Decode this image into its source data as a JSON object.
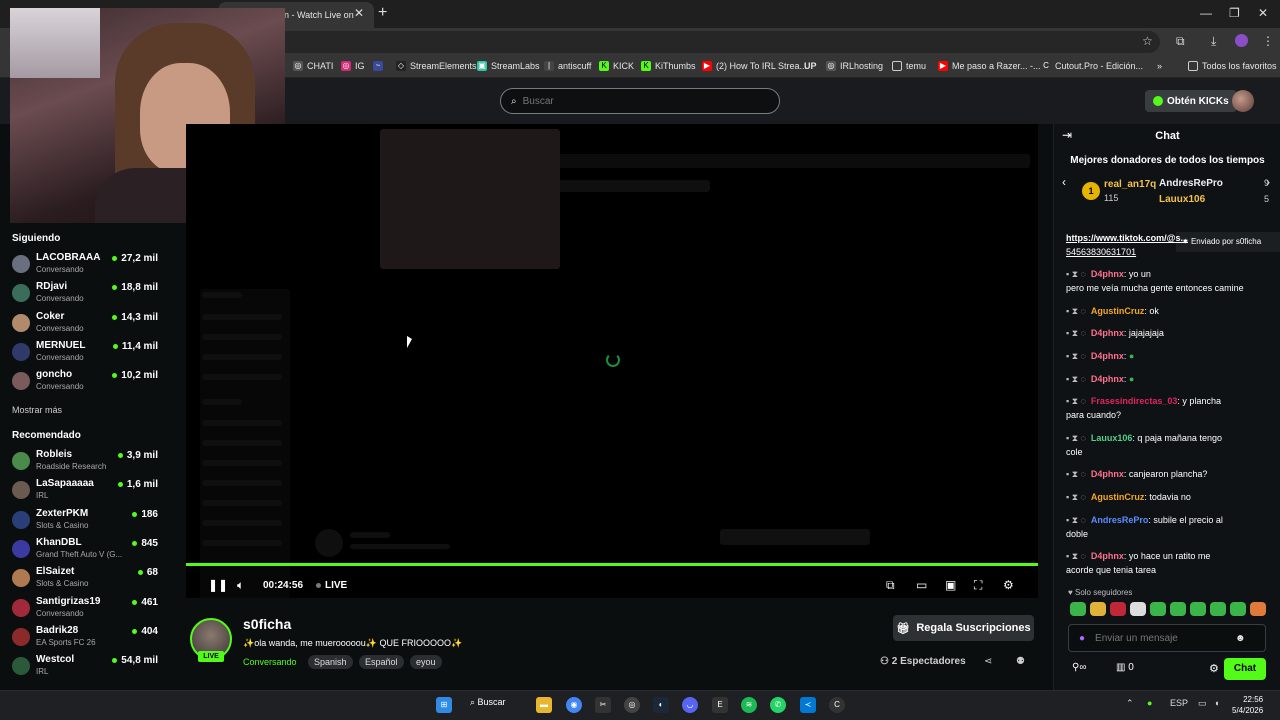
{
  "browser": {
    "active_tab_title": "n - Watch Live on",
    "bookmarks": [
      "CHATI",
      "IG",
      "StreamElements",
      "StreamLabs",
      "antiscuff",
      "KICK",
      "KiThumbs",
      "(2) How To IRL Strea...",
      "UP",
      "IRLhosting",
      "temu",
      "Me paso a Razer... -...",
      "Cutout.Pro - Edición...",
      "Todos los favoritos"
    ]
  },
  "header": {
    "search_placeholder": "Buscar",
    "kicks_label": "Obtén KICKs"
  },
  "sidebar": {
    "following_title": "Siguiendo",
    "following": [
      {
        "name": "LACOBRAAA",
        "category": "Conversando",
        "viewers": "27,2 mil"
      },
      {
        "name": "RDjavi",
        "category": "Conversando",
        "viewers": "18,8 mil"
      },
      {
        "name": "Coker",
        "category": "Conversando",
        "viewers": "14,3 mil"
      },
      {
        "name": "MERNUEL",
        "category": "Conversando",
        "viewers": "11,4 mil"
      },
      {
        "name": "goncho",
        "category": "Conversando",
        "viewers": "10,2 mil"
      }
    ],
    "show_more": "Mostrar más",
    "recommended_title": "Recomendado",
    "recommended": [
      {
        "name": "Robleis",
        "category": "Roadside Research",
        "viewers": "3,9 mil"
      },
      {
        "name": "LaSapaaaaa",
        "category": "IRL",
        "viewers": "1,6 mil"
      },
      {
        "name": "ZexterPKM",
        "category": "Slots & Casino",
        "viewers": "186"
      },
      {
        "name": "KhanDBL",
        "category": "Grand Theft Auto V (G...",
        "viewers": "845"
      },
      {
        "name": "ElSaizet",
        "category": "Slots & Casino",
        "viewers": "68"
      },
      {
        "name": "Santigrizas19",
        "category": "Conversando",
        "viewers": "461"
      },
      {
        "name": "Badrik28",
        "category": "EA Sports FC 26",
        "viewers": "404"
      },
      {
        "name": "Westcol",
        "category": "IRL",
        "viewers": "54,8 mil"
      }
    ]
  },
  "player": {
    "time": "00:24:56",
    "live_label": "LIVE"
  },
  "stream": {
    "streamer": "s0ficha",
    "live_badge": "LIVE",
    "title": "✨ola wanda, me muerooooou✨ QUE FRIOOOOO✨",
    "category": "Conversando",
    "tags": [
      "Spanish",
      "Español",
      "eyou"
    ],
    "gift_label": "Regala Suscripciones",
    "viewers_count": "2",
    "viewers_label": "Espectadores"
  },
  "chat": {
    "title": "Chat",
    "donors_title": "Mejores donadores de todos los tiempos",
    "top_donor": {
      "rank": "1",
      "name": "real_an17q",
      "amount": "115"
    },
    "donors": [
      {
        "name": "AndresRePro",
        "amount": "9",
        "color": "#f0f0f0"
      },
      {
        "name": "Lauux106",
        "amount": "5",
        "color": "#f5c14b"
      }
    ],
    "pinned": "Enviado por  s0ficha",
    "messages": [
      {
        "user": "",
        "text": "https://www.tiktok.com/@s...",
        "text2": "54563830631701",
        "color": "#ffffff"
      },
      {
        "user": "D4phnx",
        "text": ": yo un",
        "text2": "pero me veía mucha gente entonces camine",
        "color": "#ff6f8f"
      },
      {
        "user": "AgustinCruz",
        "text": ": ok",
        "text2": "",
        "color": "#f5a623"
      },
      {
        "user": "D4phnx",
        "text": ": jajajajaja",
        "text2": "",
        "color": "#ff6f8f"
      },
      {
        "user": "D4phnx",
        "text": ":",
        "text2": "",
        "color": "#ff6f8f"
      },
      {
        "user": "D4phnx",
        "text": ":",
        "text2": "",
        "color": "#ff6f8f"
      },
      {
        "user": "Frasesindirectas_03",
        "text": ": y plancha",
        "text2": "para cuando?",
        "color": "#e0245e"
      },
      {
        "user": "Lauux106",
        "text": ": q paja mañana tengo",
        "text2": "cole",
        "color": "#4fd18b"
      },
      {
        "user": "D4phnx",
        "text": ": canjearon plancha?",
        "text2": "",
        "color": "#ff6f8f"
      },
      {
        "user": "AgustinCruz",
        "text": ": todavia no",
        "text2": "",
        "color": "#f5a623"
      },
      {
        "user": "AndresRePro",
        "text": ": subile el precio al",
        "text2": "doble",
        "color": "#5b8cff"
      },
      {
        "user": "D4phnx",
        "text": ": yo hace un ratito me",
        "text2": "acorde que tenia tarea",
        "color": "#ff6f8f"
      }
    ],
    "followers_only": "Solo seguidores",
    "input_placeholder": "Enviar un mensaje",
    "points": "0",
    "send_label": "Chat"
  },
  "taskbar": {
    "search_label": "Buscar",
    "lang": "ESP",
    "time": "22:56",
    "date": "5/4/2026"
  }
}
